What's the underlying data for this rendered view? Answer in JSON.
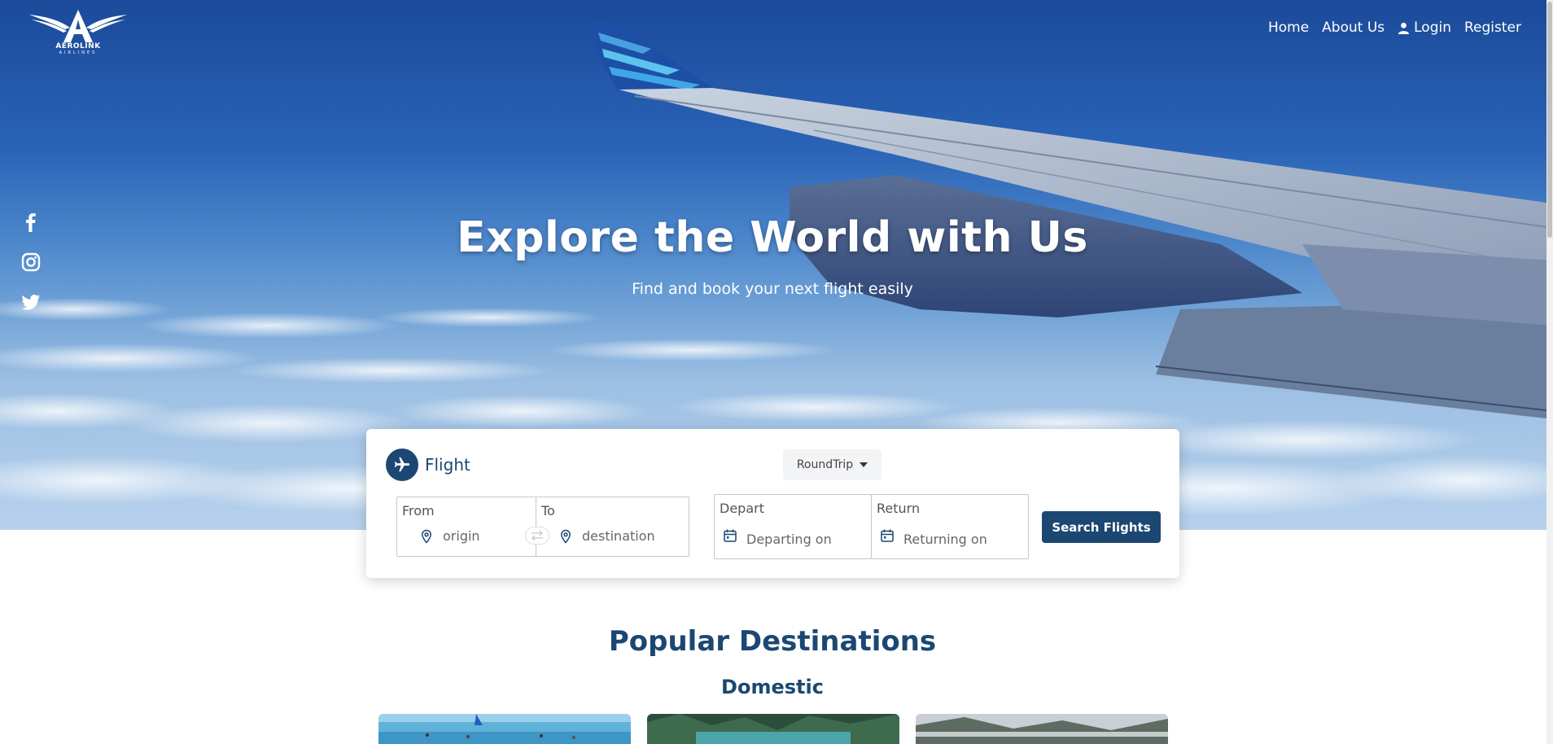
{
  "brand": {
    "name": "AEROLINK",
    "sub": "AIRLINES"
  },
  "nav": {
    "home": "Home",
    "about": "About Us",
    "login": "Login",
    "register": "Register"
  },
  "social": [
    "facebook-icon",
    "instagram-icon",
    "twitter-icon"
  ],
  "hero": {
    "title": "Explore the World with Us",
    "subtitle": "Find and book your next flight easily"
  },
  "search": {
    "title": "Flight",
    "trip_type": "RoundTrip",
    "from": {
      "label": "From",
      "placeholder": "origin"
    },
    "to": {
      "label": "To",
      "placeholder": "destination"
    },
    "depart": {
      "label": "Depart",
      "placeholder": "Departing on"
    },
    "return": {
      "label": "Return",
      "placeholder": "Returning on"
    },
    "button": "Search Flights"
  },
  "popular": {
    "title": "Popular Destinations",
    "domestic": "Domestic"
  },
  "colors": {
    "primary": "#1c4772",
    "white": "#ffffff"
  }
}
